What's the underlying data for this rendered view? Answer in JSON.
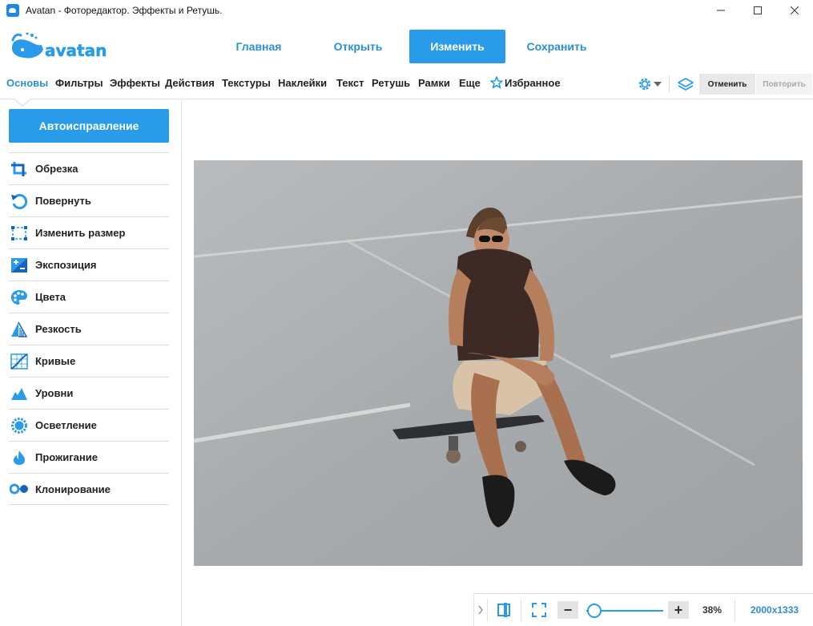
{
  "window": {
    "title": "Avatan - Фотоpедактор. Эффекты и Ретушь."
  },
  "logo": {
    "text": "avatan"
  },
  "modes": [
    {
      "label": "Главная",
      "active": false
    },
    {
      "label": "Открыть",
      "active": false
    },
    {
      "label": "Изменить",
      "active": true
    },
    {
      "label": "Сохранить",
      "active": false
    }
  ],
  "tabs": [
    {
      "label": "Основы",
      "active": true
    },
    {
      "label": "Фильтры"
    },
    {
      "label": "Эффекты"
    },
    {
      "label": "Действия"
    },
    {
      "label": "Текстуры"
    },
    {
      "label": "Наклейки"
    },
    {
      "label": "Текст"
    },
    {
      "label": "Ретушь"
    },
    {
      "label": "Рамки"
    },
    {
      "label": "Еще"
    },
    {
      "label": "Избранное",
      "icon": "star-icon"
    }
  ],
  "toolbar": {
    "undo_label": "Отменить",
    "redo_label": "Повторить"
  },
  "sidebar": {
    "auto_label": "Автоисправление",
    "tools": [
      {
        "label": "Обрезка",
        "icon": "crop-icon"
      },
      {
        "label": "Повернуть",
        "icon": "rotate-icon"
      },
      {
        "label": "Изменить размер",
        "icon": "resize-icon"
      },
      {
        "label": "Экспозиция",
        "icon": "exposure-icon"
      },
      {
        "label": "Цвета",
        "icon": "palette-icon"
      },
      {
        "label": "Резкость",
        "icon": "sharpness-icon"
      },
      {
        "label": "Кривые",
        "icon": "curves-icon"
      },
      {
        "label": "Уровни",
        "icon": "levels-icon"
      },
      {
        "label": "Осветление",
        "icon": "brighten-icon"
      },
      {
        "label": "Прожигание",
        "icon": "burn-icon"
      },
      {
        "label": "Клонирование",
        "icon": "clone-icon"
      }
    ]
  },
  "status": {
    "zoom": "38%",
    "dimensions": "2000x1333"
  },
  "colors": {
    "accent": "#2a9be8",
    "accent_text": "#2a8fd6"
  }
}
